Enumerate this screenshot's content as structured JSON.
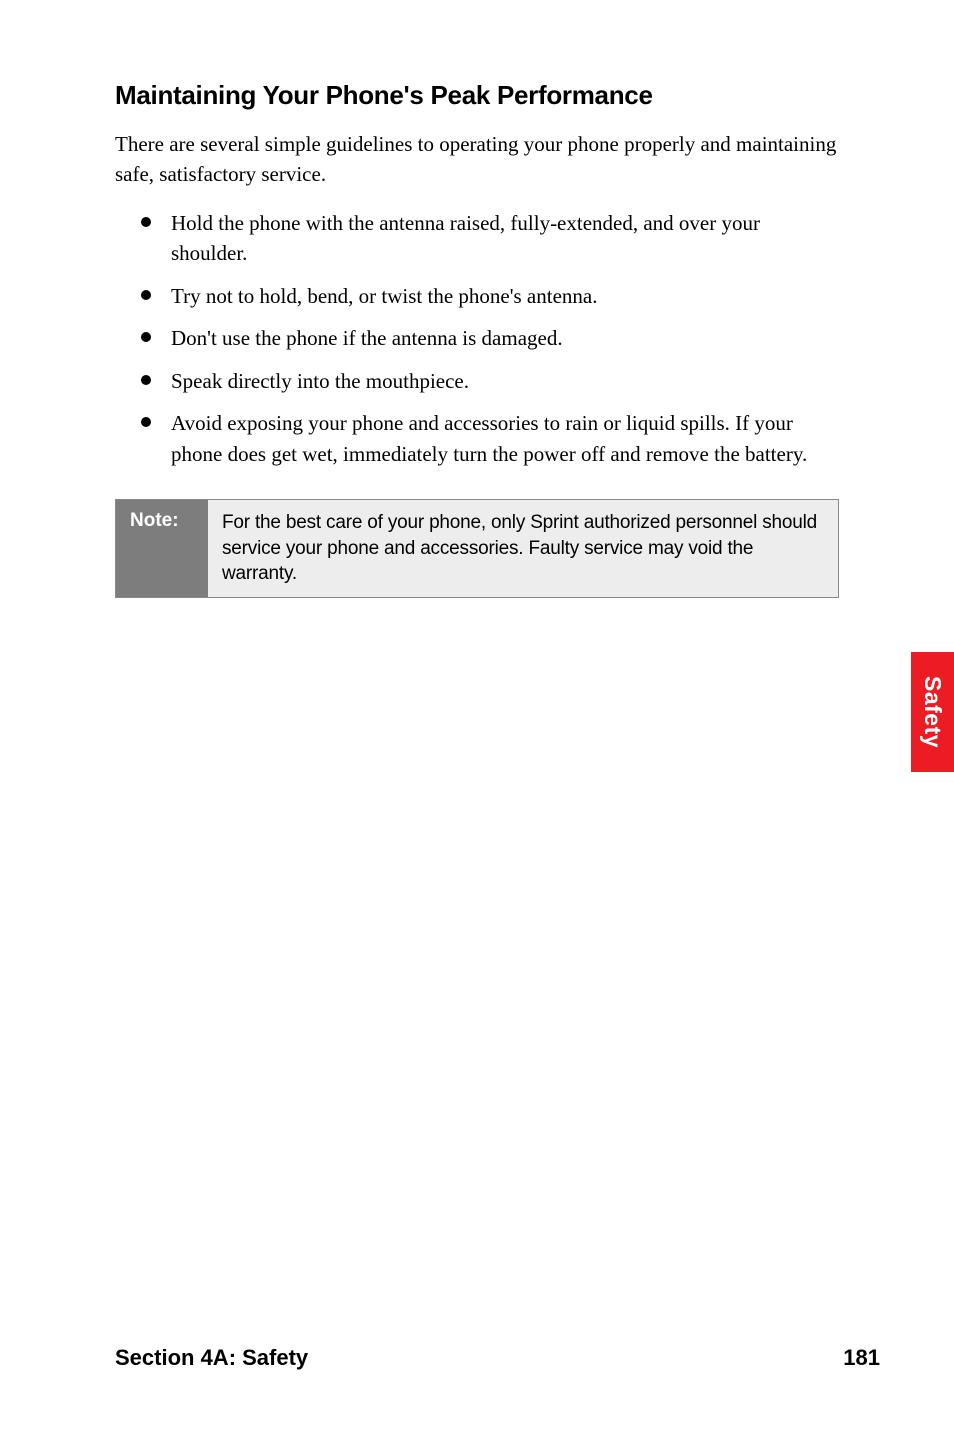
{
  "heading": "Maintaining Your Phone's Peak Performance",
  "intro": "There are several simple guidelines to operating your phone properly and maintaining safe, satisfactory service.",
  "bullets": [
    "Hold the phone with the antenna raised, fully-extended, and over your shoulder.",
    "Try not to hold, bend, or twist the phone's antenna.",
    "Don't use the phone if the antenna is damaged.",
    "Speak directly into the mouthpiece.",
    "Avoid exposing your phone and accessories to rain or liquid spills. If your phone does get wet, immediately turn the power off and remove the battery."
  ],
  "note": {
    "label": "Note:",
    "text": "For the best care of your phone, only Sprint authorized personnel should service your phone and accessories. Faulty service may void the warranty."
  },
  "sideTab": "Safety",
  "footer": {
    "section": "Section 4A: Safety",
    "page": "181"
  }
}
